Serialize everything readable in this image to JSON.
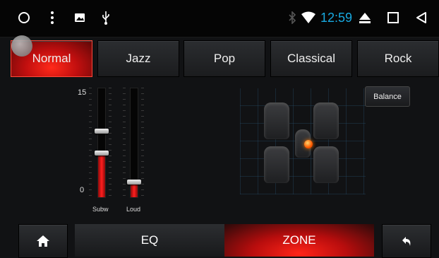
{
  "status_bar": {
    "time": "12:59",
    "icons": [
      "circle-home-icon",
      "more-vert-icon",
      "image-icon",
      "usb-icon",
      "bluetooth-icon",
      "wifi-icon",
      "eject-icon",
      "square-recent-icon",
      "triangle-back-icon"
    ]
  },
  "presets": [
    {
      "label": "Normal",
      "active": true
    },
    {
      "label": "Jazz",
      "active": false
    },
    {
      "label": "Pop",
      "active": false
    },
    {
      "label": "Classical",
      "active": false
    },
    {
      "label": "Rock",
      "active": false
    }
  ],
  "sliders": {
    "scale_max": "15",
    "scale_min": "0",
    "subw": {
      "label": "Subw",
      "value": 6
    },
    "loud": {
      "label": "Loud",
      "value": 2
    }
  },
  "balance_label": "Balance",
  "bottom_tabs": {
    "eq_label": "EQ",
    "zone_label": "ZONE",
    "active": "ZONE"
  },
  "colors": {
    "accent_red": "#e0140f",
    "time_blue": "#18a9e0"
  }
}
